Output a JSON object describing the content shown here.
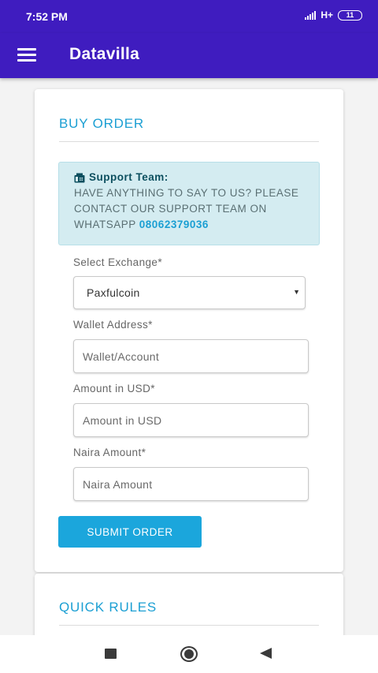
{
  "status_bar": {
    "time": "7:52 PM",
    "network": "H+",
    "battery": "11"
  },
  "app_bar": {
    "menu_icon": "hamburger-menu-icon",
    "title": "Datavilla"
  },
  "buy_order": {
    "title": "BUY ORDER",
    "alert": {
      "icon": "fax-icon",
      "heading": "Support Team:",
      "message": "HAVE ANYTHING TO SAY TO US? PLEASE CONTACT OUR SUPPORT TEAM ON WHATSAPP",
      "phone": "08062379036"
    },
    "exchange": {
      "label": "Select Exchange*",
      "selected": "Paxfulcoin"
    },
    "wallet": {
      "label": "Wallet Address*",
      "placeholder": "Wallet/Account"
    },
    "amount_usd": {
      "label": "Amount in USD*",
      "placeholder": "Amount in USD"
    },
    "naira": {
      "label": "Naira Amount*",
      "placeholder": "Naira Amount"
    },
    "submit_label": "SUBMIT ORDER"
  },
  "quick_rules": {
    "title": "QUICK RULES"
  },
  "nav_bar": {
    "recents_icon": "square-recents-icon",
    "home_icon": "circle-home-icon",
    "back_icon": "triangle-back-icon"
  },
  "colors": {
    "brand": "#3f1cbf",
    "accent": "#1ba6dc",
    "alert_bg": "#d4ecf1"
  }
}
